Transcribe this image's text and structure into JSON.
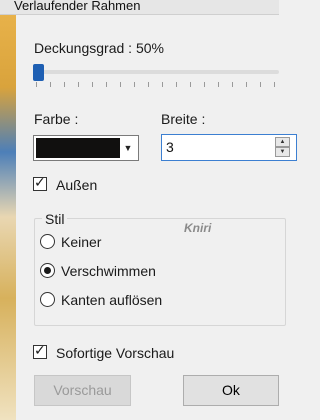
{
  "window": {
    "title": "Verlaufender Rahmen"
  },
  "opacity": {
    "label": "Deckungsgrad : 50%",
    "value_percent": 50
  },
  "color": {
    "label": "Farbe :",
    "value_hex": "#11100f"
  },
  "width": {
    "label": "Breite :",
    "value": "3"
  },
  "outside": {
    "label": "Außen",
    "checked": true
  },
  "style": {
    "title": "Stil",
    "options": [
      {
        "label": "Keiner",
        "selected": false
      },
      {
        "label": "Verschwimmen",
        "selected": true
      },
      {
        "label": "Kanten auflösen",
        "selected": false
      }
    ],
    "watermark": "Kniri"
  },
  "preview_instant": {
    "label": "Sofortige Vorschau",
    "checked": true
  },
  "buttons": {
    "preview": "Vorschau",
    "ok": "Ok"
  }
}
